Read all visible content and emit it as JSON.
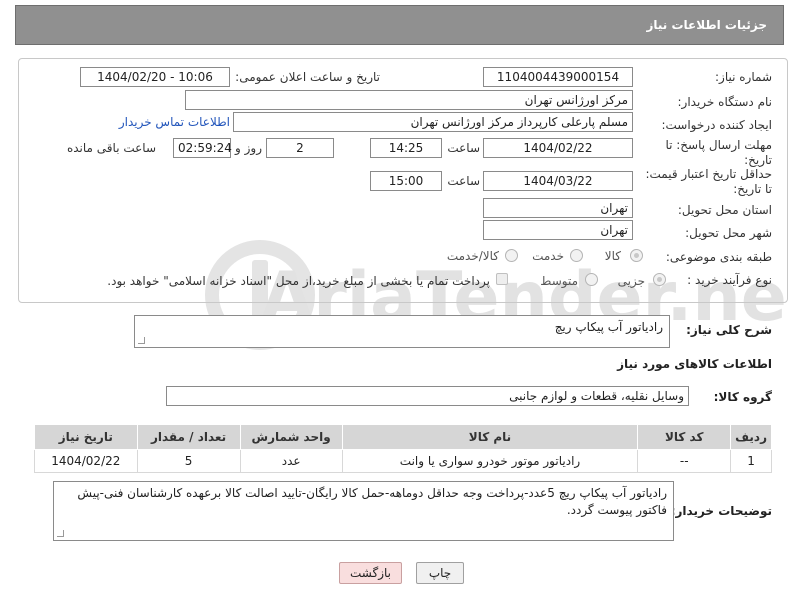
{
  "header": {
    "title": "جزئیات اطلاعات نیاز"
  },
  "form": {
    "need_number_label": "شماره نیاز:",
    "need_number": "1104004439000154",
    "announce_label": "تاریخ و ساعت اعلان عمومی:",
    "announce_value": "1404/02/20 - 10:06",
    "buyer_org_label": "نام دستگاه خریدار:",
    "buyer_org": "مرکز اورژانس تهران",
    "creator_label": "ایجاد کننده درخواست:",
    "creator": "مسلم پارعلی کارپرداز مرکز اورژانس تهران",
    "contact_link": "اطلاعات تماس خریدار",
    "reply_deadline_label": "مهلت ارسال پاسخ: تا تاریخ:",
    "reply_date": "1404/02/22",
    "time_label": "ساعت",
    "reply_time": "14:25",
    "days_value": "2",
    "days_label": "روز و",
    "remaining_time": "02:59:24",
    "remaining_label": "ساعت باقی مانده",
    "price_valid_label": "حداقل تاریخ اعتبار قیمت: تا تاریخ:",
    "price_date": "1404/03/22",
    "price_time_label": "ساعت",
    "price_time": "15:00",
    "province_label": "استان محل تحویل:",
    "province": "تهران",
    "city_label": "شهر محل تحویل:",
    "city": "تهران",
    "category_label": "طبقه بندی موضوعی:",
    "category_options": [
      "کالا",
      "خدمت",
      "کالا/خدمت"
    ],
    "process_label": "نوع فرآیند خرید :",
    "process_options": [
      "جزیی",
      "متوسط"
    ],
    "payment_note": "پرداخت تمام یا بخشی از مبلغ خرید،از محل \"اسناد خزانه اسلامی\" خواهد بود."
  },
  "description": {
    "label": "شرح کلی نیاز:",
    "value": "رادیاتور آب پیکاپ ریچ"
  },
  "goods_info": {
    "title": "اطلاعات کالاهای مورد نیاز",
    "group_label": "گروه کالا:",
    "group_value": "وسایل نقلیه، قطعات و لوازم جانبی"
  },
  "table": {
    "headers": [
      "ردیف",
      "کد کالا",
      "نام کالا",
      "واحد شمارش",
      "تعداد / مقدار",
      "تاریخ نیاز"
    ],
    "rows": [
      [
        "1",
        "--",
        "رادیاتور موتور خودرو سواری یا وانت",
        "عدد",
        "5",
        "1404/02/22"
      ]
    ]
  },
  "buyer_notes": {
    "label": "توضیحات خریدار:",
    "value": "رادیاتور آب پیکاپ ریچ   5عدد-پرداخت وجه حداقل دوماهه-حمل کالا رایگان-تایید اصالت کالا برعهده کارشناسان فنی-پیش فاکتور پیوست گردد."
  },
  "buttons": {
    "print": "چاپ",
    "back": "بازگشت"
  },
  "watermark": {
    "text": "AriaTender.net"
  }
}
